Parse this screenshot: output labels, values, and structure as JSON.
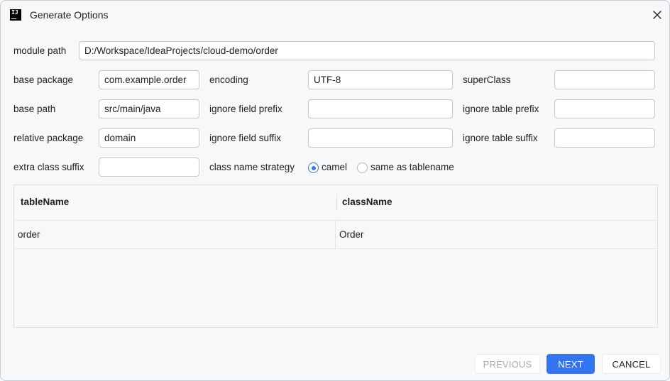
{
  "window": {
    "title": "Generate Options",
    "app_icon_text": "IJ"
  },
  "form": {
    "module_path": {
      "label": "module path",
      "value": "D:/Workspace/IdeaProjects/cloud-demo/order"
    },
    "base_package": {
      "label": "base package",
      "value": "com.example.order"
    },
    "encoding": {
      "label": "encoding",
      "value": "UTF-8"
    },
    "super_class": {
      "label": "superClass",
      "value": ""
    },
    "base_path": {
      "label": "base path",
      "value": "src/main/java"
    },
    "ignore_field_prefix": {
      "label": "ignore field prefix",
      "value": ""
    },
    "ignore_table_prefix": {
      "label": "ignore table prefix",
      "value": ""
    },
    "relative_package": {
      "label": "relative package",
      "value": "domain"
    },
    "ignore_field_suffix": {
      "label": "ignore field suffix",
      "value": ""
    },
    "ignore_table_suffix": {
      "label": "ignore table suffix",
      "value": ""
    },
    "extra_class_suffix": {
      "label": "extra class suffix",
      "value": ""
    },
    "class_name_strategy": {
      "label": "class name strategy",
      "options": [
        "camel",
        "same as tablename"
      ],
      "selected": "camel"
    }
  },
  "table": {
    "columns": [
      "tableName",
      "className"
    ],
    "rows": [
      [
        "order",
        "Order"
      ]
    ]
  },
  "buttons": {
    "previous": "PREVIOUS",
    "next": "NEXT",
    "cancel": "CANCEL",
    "previous_enabled": false
  },
  "colors": {
    "accent": "#3574f0",
    "background": "#f7f8fa"
  }
}
